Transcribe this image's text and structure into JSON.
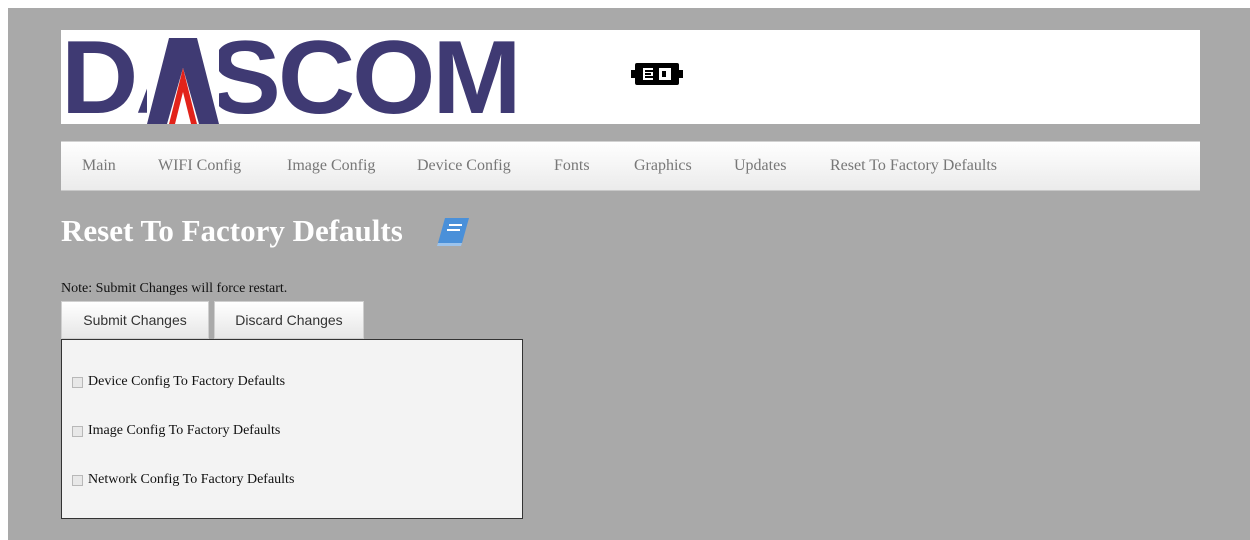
{
  "header": {
    "logo_text": "DASCOM",
    "battery_icon": "battery-plug-icon"
  },
  "nav": {
    "items": [
      {
        "label": "Main"
      },
      {
        "label": "WIFI Config"
      },
      {
        "label": "Image Config"
      },
      {
        "label": "Device Config"
      },
      {
        "label": "Fonts"
      },
      {
        "label": "Graphics"
      },
      {
        "label": "Updates"
      },
      {
        "label": "Reset To Factory Defaults"
      }
    ]
  },
  "main": {
    "title": "Reset To Factory Defaults",
    "title_icon": "book-icon",
    "note": "Note: Submit Changes will force restart.",
    "submit_label": "Submit Changes",
    "discard_label": "Discard Changes",
    "options": [
      {
        "label": "Device Config To Factory Defaults",
        "checked": false
      },
      {
        "label": "Image Config To Factory Defaults",
        "checked": false
      },
      {
        "label": "Network Config To Factory Defaults",
        "checked": false
      }
    ]
  },
  "colors": {
    "background": "#a9a9a9",
    "logo_purple": "#3f3a73",
    "logo_red": "#e2231a",
    "book_blue": "#4a90d9"
  }
}
